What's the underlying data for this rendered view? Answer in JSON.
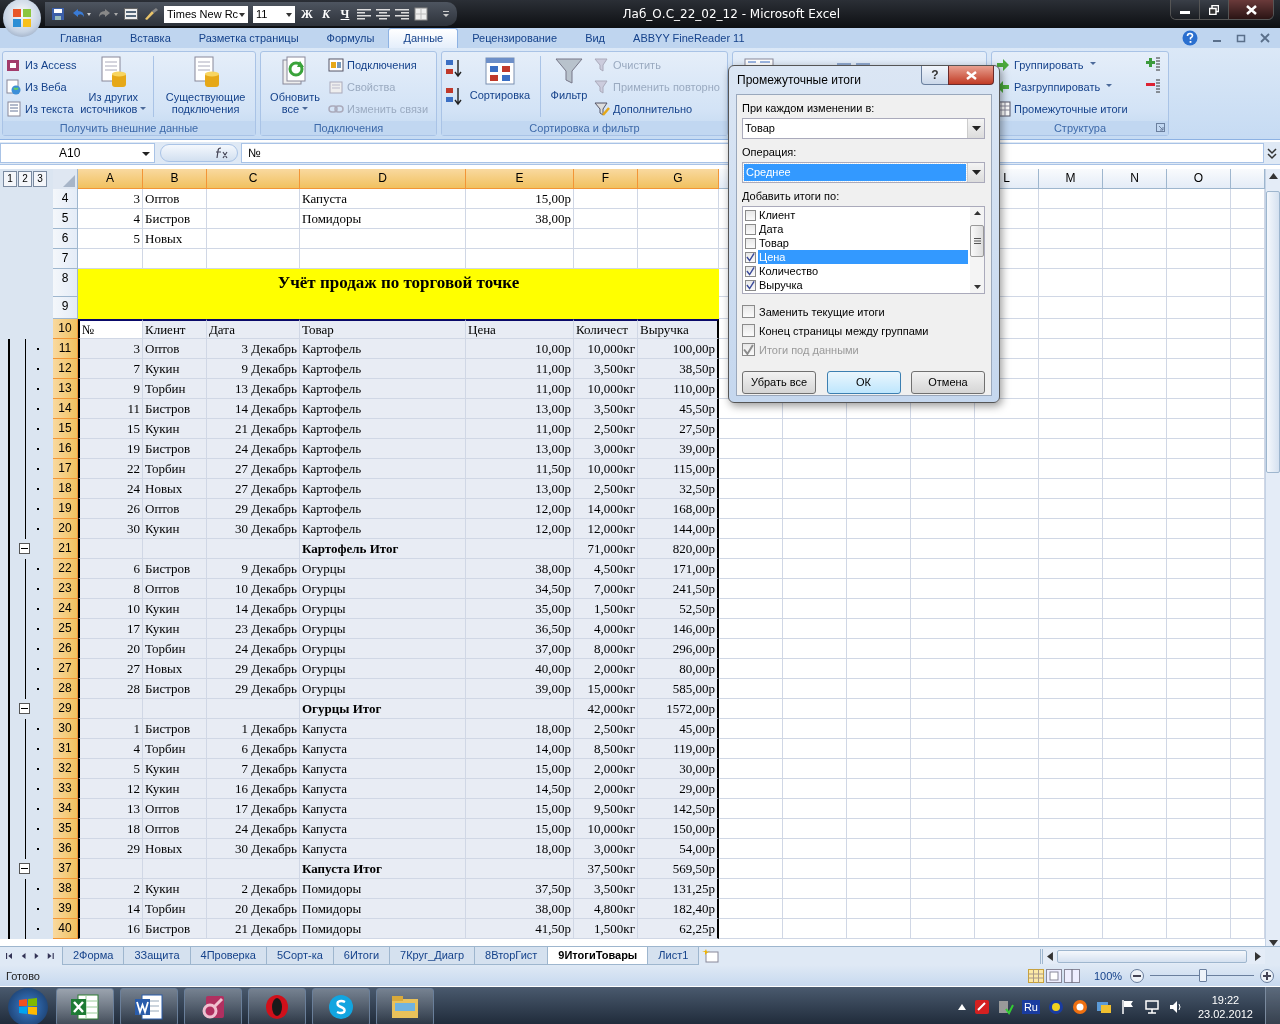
{
  "window": {
    "title": "Лаб_О.С_22_02_12 - Microsoft Excel"
  },
  "quick_access": {
    "font": "Times New Rc",
    "size": "11",
    "styles": [
      "Ж",
      "К",
      "Ч"
    ]
  },
  "tabs": [
    {
      "label": "Главная",
      "selected": false
    },
    {
      "label": "Вставка",
      "selected": false
    },
    {
      "label": "Разметка страницы",
      "selected": false
    },
    {
      "label": "Формулы",
      "selected": false
    },
    {
      "label": "Данные",
      "selected": true
    },
    {
      "label": "Рецензирование",
      "selected": false
    },
    {
      "label": "Вид",
      "selected": false
    },
    {
      "label": "ABBYY FineReader 11",
      "selected": false
    }
  ],
  "ribbon": {
    "groups": [
      {
        "label": "Получить внешние данные",
        "items": [
          {
            "label": "Из Access",
            "disabled": false
          },
          {
            "label": "Из Веба",
            "disabled": false
          },
          {
            "label": "Из текста",
            "disabled": false
          },
          {
            "label": "Из других источников",
            "disabled": false
          },
          {
            "label": "Существующие подключения",
            "disabled": false
          }
        ]
      },
      {
        "label": "Подключения",
        "items": [
          {
            "label": "Обновить все",
            "disabled": false
          },
          {
            "label": "Подключения",
            "disabled": false
          },
          {
            "label": "Свойства",
            "disabled": true
          },
          {
            "label": "Изменить связи",
            "disabled": true
          }
        ]
      },
      {
        "label": "Сортировка и фильтр",
        "items": [
          {
            "label": "Сортировка",
            "disabled": false
          },
          {
            "label": "Фильтр",
            "disabled": false
          },
          {
            "label": "Очистить",
            "disabled": true
          },
          {
            "label": "Применить повторно",
            "disabled": true
          },
          {
            "label": "Дополнительно",
            "disabled": false
          }
        ]
      },
      {
        "label": "Структура",
        "items": [
          {
            "label": "Группировать",
            "disabled": false
          },
          {
            "label": "Разгруппировать",
            "disabled": false
          },
          {
            "label": "Промежуточные итоги",
            "disabled": false
          }
        ]
      }
    ]
  },
  "formula_bar": {
    "name_box": "A10",
    "value": "№"
  },
  "outline_levels": [
    "1",
    "2",
    "3"
  ],
  "columns": [
    "A",
    "B",
    "C",
    "D",
    "E",
    "F",
    "G"
  ],
  "more_columns": [
    "L",
    "M",
    "N",
    "O"
  ],
  "rows": [
    {
      "kind": "plain",
      "num": "4",
      "cells": [
        "3",
        "Оптов",
        "",
        "Капуста",
        "15,00р",
        "",
        ""
      ]
    },
    {
      "kind": "plain",
      "num": "5",
      "cells": [
        "4",
        "Бистров",
        "",
        "Помидоры",
        "38,00р",
        "",
        ""
      ]
    },
    {
      "kind": "plain",
      "num": "6",
      "cells": [
        "5",
        "Новых",
        "",
        "",
        "",
        "",
        ""
      ]
    },
    {
      "kind": "plain",
      "num": "7",
      "cells": [
        "",
        "",
        "",
        "",
        "",
        "",
        ""
      ]
    },
    {
      "kind": "title",
      "nums": [
        "8",
        "9"
      ],
      "text": "Учёт продаж по торговой точке"
    },
    {
      "kind": "header",
      "num": "10",
      "cells": [
        "№",
        "Клиент",
        "Дата",
        "Товар",
        "Цена",
        "Количест",
        "Выручка"
      ]
    },
    {
      "kind": "data",
      "num": "11",
      "cells": [
        "3",
        "Оптов",
        "3 Декабрь",
        "Картофель",
        "10,00р",
        "10,000кг",
        "100,00р"
      ]
    },
    {
      "kind": "data",
      "num": "12",
      "cells": [
        "7",
        "Кукин",
        "9 Декабрь",
        "Картофель",
        "11,00р",
        "3,500кг",
        "38,50р"
      ]
    },
    {
      "kind": "data",
      "num": "13",
      "cells": [
        "9",
        "Торбин",
        "13 Декабрь",
        "Картофель",
        "11,00р",
        "10,000кг",
        "110,00р"
      ]
    },
    {
      "kind": "data",
      "num": "14",
      "cells": [
        "11",
        "Бистров",
        "14 Декабрь",
        "Картофель",
        "13,00р",
        "3,500кг",
        "45,50р"
      ]
    },
    {
      "kind": "data",
      "num": "15",
      "cells": [
        "15",
        "Кукин",
        "21 Декабрь",
        "Картофель",
        "11,00р",
        "2,500кг",
        "27,50р"
      ]
    },
    {
      "kind": "data",
      "num": "16",
      "cells": [
        "19",
        "Бистров",
        "24 Декабрь",
        "Картофель",
        "13,00р",
        "3,000кг",
        "39,00р"
      ]
    },
    {
      "kind": "data",
      "num": "17",
      "cells": [
        "22",
        "Торбин",
        "27 Декабрь",
        "Картофель",
        "11,50р",
        "10,000кг",
        "115,00р"
      ]
    },
    {
      "kind": "data",
      "num": "18",
      "cells": [
        "24",
        "Новых",
        "27 Декабрь",
        "Картофель",
        "13,00р",
        "2,500кг",
        "32,50р"
      ]
    },
    {
      "kind": "data",
      "num": "19",
      "cells": [
        "26",
        "Оптов",
        "29 Декабрь",
        "Картофель",
        "12,00р",
        "14,000кг",
        "168,00р"
      ]
    },
    {
      "kind": "data",
      "num": "20",
      "cells": [
        "30",
        "Кукин",
        "30 Декабрь",
        "Картофель",
        "12,00р",
        "12,000кг",
        "144,00р"
      ]
    },
    {
      "kind": "total",
      "num": "21",
      "cells": [
        "",
        "",
        "",
        "Картофель Итог",
        "",
        "71,000кг",
        "820,00р"
      ]
    },
    {
      "kind": "data",
      "num": "22",
      "cells": [
        "6",
        "Бистров",
        "9 Декабрь",
        "Огурцы",
        "38,00р",
        "4,500кг",
        "171,00р"
      ]
    },
    {
      "kind": "data",
      "num": "23",
      "cells": [
        "8",
        "Оптов",
        "10 Декабрь",
        "Огурцы",
        "34,50р",
        "7,000кг",
        "241,50р"
      ]
    },
    {
      "kind": "data",
      "num": "24",
      "cells": [
        "10",
        "Кукин",
        "14 Декабрь",
        "Огурцы",
        "35,00р",
        "1,500кг",
        "52,50р"
      ]
    },
    {
      "kind": "data",
      "num": "25",
      "cells": [
        "17",
        "Кукин",
        "23 Декабрь",
        "Огурцы",
        "36,50р",
        "4,000кг",
        "146,00р"
      ]
    },
    {
      "kind": "data",
      "num": "26",
      "cells": [
        "20",
        "Торбин",
        "24 Декабрь",
        "Огурцы",
        "37,00р",
        "8,000кг",
        "296,00р"
      ]
    },
    {
      "kind": "data",
      "num": "27",
      "cells": [
        "27",
        "Новых",
        "29 Декабрь",
        "Огурцы",
        "40,00р",
        "2,000кг",
        "80,00р"
      ]
    },
    {
      "kind": "data",
      "num": "28",
      "cells": [
        "28",
        "Бистров",
        "29 Декабрь",
        "Огурцы",
        "39,00р",
        "15,000кг",
        "585,00р"
      ]
    },
    {
      "kind": "total",
      "num": "29",
      "cells": [
        "",
        "",
        "",
        "Огурцы Итог",
        "",
        "42,000кг",
        "1572,00р"
      ]
    },
    {
      "kind": "data",
      "num": "30",
      "cells": [
        "1",
        "Бистров",
        "1 Декабрь",
        "Капуста",
        "18,00р",
        "2,500кг",
        "45,00р"
      ]
    },
    {
      "kind": "data",
      "num": "31",
      "cells": [
        "4",
        "Торбин",
        "6 Декабрь",
        "Капуста",
        "14,00р",
        "8,500кг",
        "119,00р"
      ]
    },
    {
      "kind": "data",
      "num": "32",
      "cells": [
        "5",
        "Кукин",
        "7 Декабрь",
        "Капуста",
        "15,00р",
        "2,000кг",
        "30,00р"
      ]
    },
    {
      "kind": "data",
      "num": "33",
      "cells": [
        "12",
        "Кукин",
        "16 Декабрь",
        "Капуста",
        "14,50р",
        "2,000кг",
        "29,00р"
      ]
    },
    {
      "kind": "data",
      "num": "34",
      "cells": [
        "13",
        "Оптов",
        "17 Декабрь",
        "Капуста",
        "15,00р",
        "9,500кг",
        "142,50р"
      ]
    },
    {
      "kind": "data",
      "num": "35",
      "cells": [
        "18",
        "Оптов",
        "24 Декабрь",
        "Капуста",
        "15,00р",
        "10,000кг",
        "150,00р"
      ]
    },
    {
      "kind": "data",
      "num": "36",
      "cells": [
        "29",
        "Новых",
        "30 Декабрь",
        "Капуста",
        "18,00р",
        "3,000кг",
        "54,00р"
      ]
    },
    {
      "kind": "total",
      "num": "37",
      "cells": [
        "",
        "",
        "",
        "Капуста Итог",
        "",
        "37,500кг",
        "569,50р"
      ]
    },
    {
      "kind": "data",
      "num": "38",
      "cells": [
        "2",
        "Кукин",
        "2 Декабрь",
        "Помидоры",
        "37,50р",
        "3,500кг",
        "131,25р"
      ]
    },
    {
      "kind": "data",
      "num": "39",
      "cells": [
        "14",
        "Торбин",
        "20 Декабрь",
        "Помидоры",
        "38,00р",
        "4,800кг",
        "182,40р"
      ]
    },
    {
      "kind": "data",
      "num": "40",
      "cells": [
        "16",
        "Бистров",
        "21 Декабрь",
        "Помидоры",
        "41,50р",
        "1,500кг",
        "62,25р"
      ]
    }
  ],
  "dialog": {
    "title": "Промежуточные итоги",
    "help": "?",
    "group_by": {
      "label": "При каждом изменении в:",
      "value": "Товар"
    },
    "operation": {
      "label": "Операция:",
      "value": "Среднее"
    },
    "add_label": "Добавить итоги по:",
    "fields": [
      {
        "label": "Клиент",
        "checked": false,
        "selected": false
      },
      {
        "label": "Дата",
        "checked": false,
        "selected": false
      },
      {
        "label": "Товар",
        "checked": false,
        "selected": false
      },
      {
        "label": "Цена",
        "checked": true,
        "selected": true
      },
      {
        "label": "Количество",
        "checked": true,
        "selected": false
      },
      {
        "label": "Выручка",
        "checked": true,
        "selected": false
      }
    ],
    "options": [
      {
        "label": "Заменить текущие итоги",
        "checked": false,
        "disabled": false
      },
      {
        "label": "Конец страницы между группами",
        "checked": false,
        "disabled": false
      },
      {
        "label": "Итоги под данными",
        "checked": true,
        "disabled": true
      }
    ],
    "buttons": [
      "Убрать все",
      "ОК",
      "Отмена"
    ]
  },
  "sheet_tabs": [
    {
      "label": "2Форма",
      "selected": false
    },
    {
      "label": "3Защита",
      "selected": false
    },
    {
      "label": "4Проверка",
      "selected": false
    },
    {
      "label": "5Сорт-ка",
      "selected": false
    },
    {
      "label": "6Итоги",
      "selected": false
    },
    {
      "label": "7Круг_Диагр",
      "selected": false
    },
    {
      "label": "8ВторГист",
      "selected": false
    },
    {
      "label": "9ИтогиТовары",
      "selected": true
    },
    {
      "label": "Лист1",
      "selected": false
    }
  ],
  "status_bar": {
    "text": "Готово",
    "zoom": "100%",
    "zoom_slider": {
      "level": 0.5
    }
  },
  "taskbar": {
    "language": "Ru",
    "time": "19:22",
    "date": "23.02.2012"
  }
}
